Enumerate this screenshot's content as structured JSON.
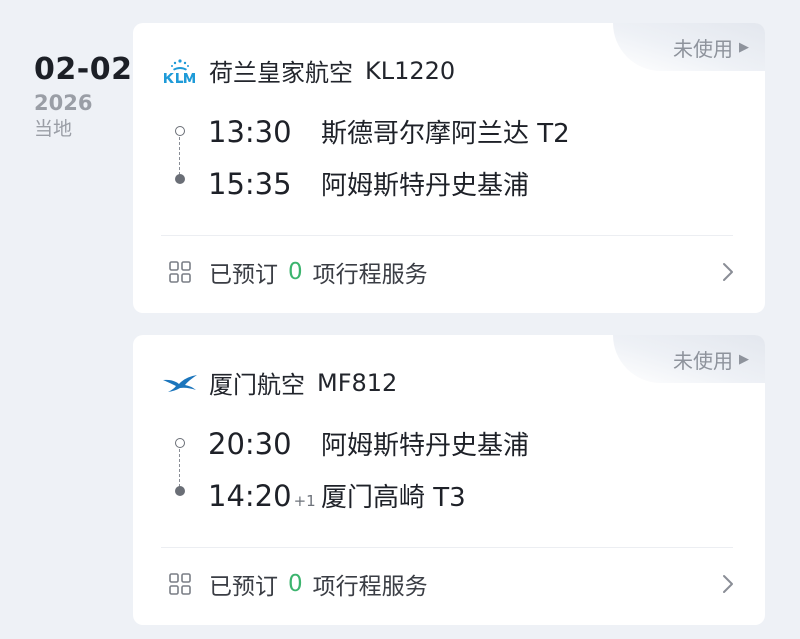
{
  "date": {
    "day": "02-02",
    "year": "2026",
    "zone": "当地"
  },
  "flights": [
    {
      "status": "未使用",
      "airline": "荷兰皇家航空",
      "flight_no": "KL1220",
      "logo_icon": "klm-logo",
      "departure": {
        "time": "13:30",
        "airport": "斯德哥尔摩阿兰达 T2"
      },
      "arrival": {
        "time": "15:35",
        "day_offset": "",
        "airport": "阿姆斯特丹史基浦"
      },
      "services": {
        "booked_label": "已预订",
        "count": "0",
        "suffix": "项行程服务"
      }
    },
    {
      "status": "未使用",
      "airline": "厦门航空",
      "flight_no": "MF812",
      "logo_icon": "xiamen-airlines-egret-logo",
      "departure": {
        "time": "20:30",
        "airport": "阿姆斯特丹史基浦"
      },
      "arrival": {
        "time": "14:20",
        "day_offset": "+1",
        "airport": "厦门高崎 T3"
      },
      "services": {
        "booked_label": "已预订",
        "count": "0",
        "suffix": "项行程服务"
      }
    }
  ],
  "colors": {
    "background": "#eef1f6",
    "card": "#ffffff",
    "klm_blue": "#1f9bd8",
    "xiamen_blue": "#1b75bc",
    "count_green": "#3cb46e",
    "muted": "#9a9ea6"
  }
}
